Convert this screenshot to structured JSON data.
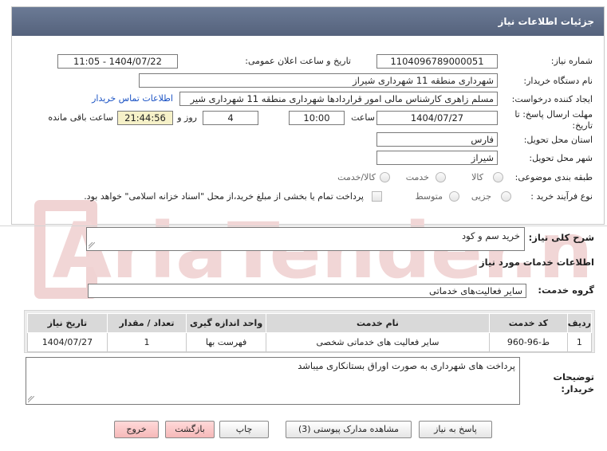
{
  "header": {
    "title": "جزئیات اطلاعات نیاز"
  },
  "fields": {
    "need_number_label": "شماره نیاز:",
    "need_number": "1104096789000051",
    "announce_label": "تاریخ و ساعت اعلان عمومی:",
    "announce_value": "1404/07/22 - 11:05",
    "buyer_org_label": "نام دستگاه خریدار:",
    "buyer_org": "شهرداری منطقه 11 شهرداری شیراز",
    "creator_label": "ایجاد کننده درخواست:",
    "creator": "مسلم زاهری کارشناس مالی امور قراردادها شهرداری منطقه 11 شهرداری شیر",
    "contact_link": "اطلاعات تماس خریدار",
    "deadline_label_1": "مهلت ارسال پاسخ: تا",
    "deadline_label_2": "تاریخ:",
    "deadline_date": "1404/07/27",
    "time_label": "ساعت",
    "deadline_time": "10:00",
    "days": "4",
    "days_label": "روز و",
    "remaining": "21:44:56",
    "remaining_label": "ساعت باقی مانده",
    "province_label": "استان محل تحویل:",
    "province": "فارس",
    "city_label": "شهر محل تحویل:",
    "city": "شیراز",
    "category_label": "طبقه بندی موضوعی:",
    "category_options": [
      "کالا",
      "خدمت",
      "کالا/خدمت"
    ],
    "process_label": "نوع فرآیند خرید :",
    "process_options": [
      "جزیی",
      "متوسط"
    ],
    "payment_note": "پرداخت تمام یا بخشی از مبلغ خرید،از محل \"اسناد خزانه اسلامی\" خواهد بود."
  },
  "summary": {
    "label": "شرح کلی نیاز:",
    "value": "خرید سم و کود"
  },
  "services_title": "اطلاعات خدمات مورد نیاز",
  "service_group": {
    "label": "گروه خدمت:",
    "value": "سایر فعالیت‌های خدماتی"
  },
  "table": {
    "headers": [
      "ردیف",
      "کد خدمت",
      "نام خدمت",
      "واحد اندازه گیری",
      "تعداد / مقدار",
      "تاریخ نیاز"
    ],
    "rows": [
      [
        "1",
        "ط-96-960",
        "سایر فعالیت های خدماتی شخصی",
        "فهرست بها",
        "1",
        "1404/07/27"
      ]
    ]
  },
  "buyer_notes": {
    "label_1": "توضیحات",
    "label_2": "خریدار:",
    "value": "پرداخت های شهرداری به صورت اوراق بستانکاری میباشد"
  },
  "buttons": {
    "reply": "پاسخ به نیاز",
    "attachments": "مشاهده مدارک پیوستی (3)",
    "print": "چاپ",
    "back": "بازگشت",
    "exit": "خروج"
  },
  "watermark_text": "AriaTender.net",
  "colors": {
    "header": "#5f6c86",
    "link": "#1a52c4",
    "watermark": "#f1d6d6"
  }
}
